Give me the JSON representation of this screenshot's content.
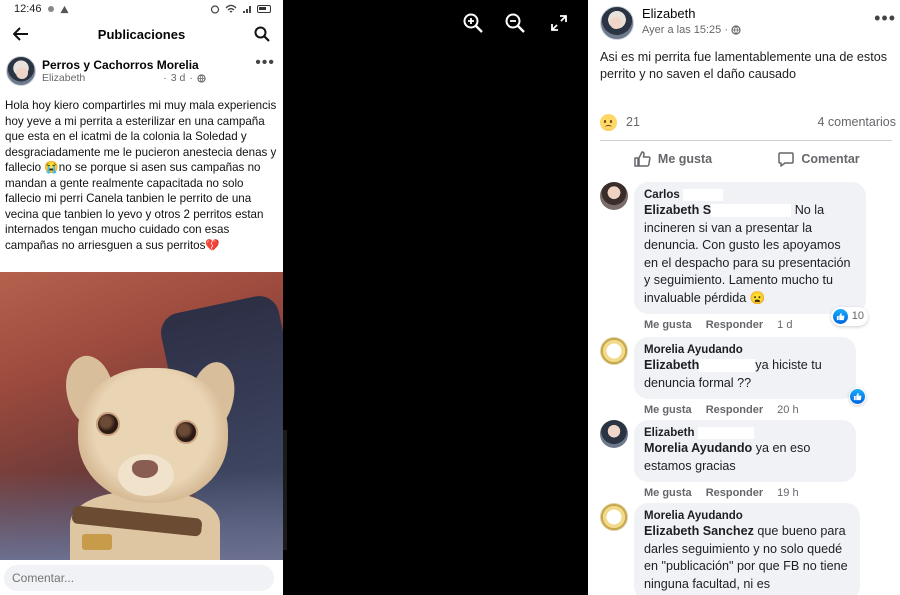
{
  "phone": {
    "status": {
      "time": "12:46"
    },
    "appbar": {
      "title": "Publicaciones"
    },
    "post": {
      "group": "Perros y Cachorros Morelia",
      "author": "Elizabeth",
      "age": "3 d",
      "text": "Hola hoy kiero compartirles mi muy mala experiencis hoy yeve a mi perrita a esterilizar en una campaña que esta en el icatmi de la colonia la Soledad y desgraciadamente me le pucieron anestecia denas y fallecio 😭no se porque si asen sus campañas no mandan a gente realmente capacitada no solo fallecio mi perri Canela tanbien le perrito de una vecina que tanbien lo yevo y otros 2 perritos estan internados tengan mucho cuidado con esas campañas no arriesguen a sus perritos💔"
    },
    "comment_placeholder": "Comentar..."
  },
  "viewer": {
    "icons": [
      "zoom-in-icon",
      "zoom-out-icon",
      "fullscreen-icon"
    ]
  },
  "fb_post": {
    "author": "Elizabeth",
    "time": "Ayer a las 15:25 ·",
    "text": "Asi es mi perrita fue lamentablemente una de estos perrito y no saven el daño causado",
    "reaction_count": "21",
    "comments_count": "4 comentarios",
    "actions": {
      "like": "Me gusta",
      "comment": "Comentar"
    },
    "comments": [
      {
        "author": "Carlos",
        "mention": "Elizabeth S",
        "text": "No la incineren si van a presentar la denuncia. Con gusto les apoyamos en el despacho para su presentación y seguimiento. Lamento mucho tu invaluable pérdida 😦",
        "like": "Me gusta",
        "reply": "Responder",
        "time": "1 d",
        "likes": "10"
      },
      {
        "author": "Morelia Ayudando",
        "mention": "Elizabeth",
        "text": "ya hiciste tu denuncia formal ??",
        "like": "Me gusta",
        "reply": "Responder",
        "time": "20 h"
      },
      {
        "author": "Elizabeth",
        "mention": "Morelia Ayudando",
        "text": "ya en eso estamos gracias",
        "like": "Me gusta",
        "reply": "Responder",
        "time": "19 h"
      },
      {
        "author": "Morelia Ayudando",
        "mention": "Elizabeth Sanchez",
        "text": "que bueno para darles seguimiento y no solo quedé en \"publicación\" por que FB no tiene ninguna facultad, ni es"
      }
    ]
  },
  "colors": {
    "fb_blue": "#1877f2",
    "muted": "#65676b",
    "bubble": "#f0f2f5"
  }
}
